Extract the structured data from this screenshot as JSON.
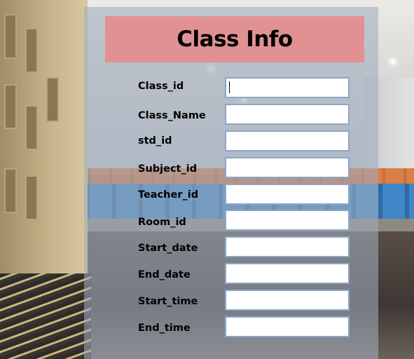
{
  "form": {
    "title": "Class Info",
    "fields": [
      {
        "label": "Class_id",
        "value": ""
      },
      {
        "label": "Class_Name",
        "value": ""
      },
      {
        "label": "std_id",
        "value": ""
      },
      {
        "label": "Subject_id",
        "value": ""
      },
      {
        "label": "Teacher_id",
        "value": ""
      },
      {
        "label": "Room_id",
        "value": ""
      },
      {
        "label": "Start_date",
        "value": ""
      },
      {
        "label": "End_date",
        "value": ""
      },
      {
        "label": "Start_time",
        "value": ""
      },
      {
        "label": "End_time",
        "value": ""
      }
    ]
  },
  "colors": {
    "title_bar": "#e58c8c",
    "panel": "#a0acbe",
    "input_border": "#8ca6c8"
  }
}
